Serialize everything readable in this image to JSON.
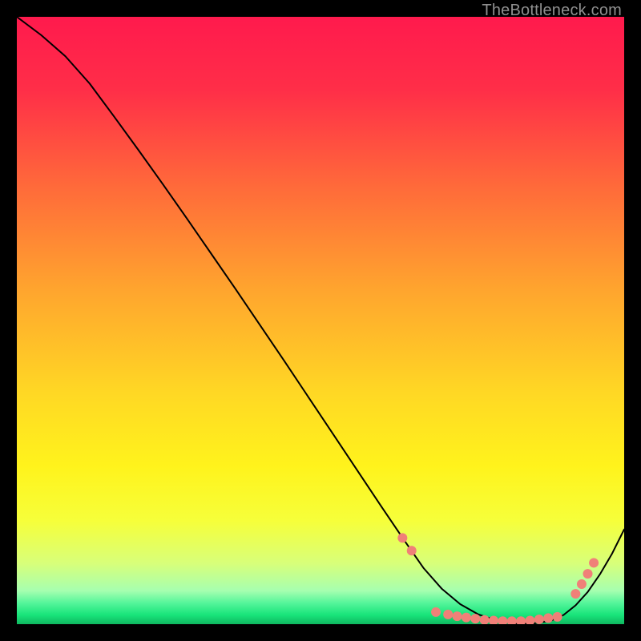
{
  "watermark": "TheBottleneck.com",
  "chart_data": {
    "type": "line",
    "title": "",
    "xlabel": "",
    "ylabel": "",
    "xlim": [
      0,
      100
    ],
    "ylim": [
      0,
      100
    ],
    "gradient_stops": [
      {
        "offset": 0.0,
        "color": "#ff1a4d"
      },
      {
        "offset": 0.12,
        "color": "#ff2e48"
      },
      {
        "offset": 0.28,
        "color": "#ff6a3a"
      },
      {
        "offset": 0.45,
        "color": "#ffa52e"
      },
      {
        "offset": 0.62,
        "color": "#ffd824"
      },
      {
        "offset": 0.74,
        "color": "#fff31c"
      },
      {
        "offset": 0.83,
        "color": "#f6ff3a"
      },
      {
        "offset": 0.9,
        "color": "#d8ff7a"
      },
      {
        "offset": 0.945,
        "color": "#a6ffb0"
      },
      {
        "offset": 0.965,
        "color": "#55f59a"
      },
      {
        "offset": 0.985,
        "color": "#18e47a"
      },
      {
        "offset": 1.0,
        "color": "#0fb85f"
      }
    ],
    "series": [
      {
        "name": "bottleneck-curve",
        "stroke": "#000000",
        "stroke_width": 2,
        "x": [
          0,
          4,
          8,
          12,
          16,
          20,
          24,
          28,
          32,
          36,
          40,
          44,
          48,
          52,
          56,
          60,
          64,
          67,
          70,
          73,
          76,
          79,
          82,
          85,
          88,
          90,
          92,
          94,
          96,
          98,
          100
        ],
        "y": [
          100,
          97,
          93.5,
          89,
          83.6,
          78.1,
          72.5,
          66.8,
          61.0,
          55.2,
          49.3,
          43.4,
          37.4,
          31.4,
          25.4,
          19.4,
          13.5,
          9.2,
          5.8,
          3.3,
          1.6,
          0.6,
          0.1,
          0.1,
          0.6,
          1.5,
          3.1,
          5.3,
          8.2,
          11.6,
          15.6
        ]
      }
    ],
    "markers": {
      "color": "#f08078",
      "radius": 6,
      "points": [
        {
          "x": 63.5,
          "y": 14.2
        },
        {
          "x": 65.0,
          "y": 12.1
        },
        {
          "x": 69.0,
          "y": 2.0
        },
        {
          "x": 71.0,
          "y": 1.6
        },
        {
          "x": 72.5,
          "y": 1.3
        },
        {
          "x": 74.0,
          "y": 1.1
        },
        {
          "x": 75.5,
          "y": 0.9
        },
        {
          "x": 77.0,
          "y": 0.7
        },
        {
          "x": 78.5,
          "y": 0.6
        },
        {
          "x": 80.0,
          "y": 0.5
        },
        {
          "x": 81.5,
          "y": 0.5
        },
        {
          "x": 83.0,
          "y": 0.5
        },
        {
          "x": 84.5,
          "y": 0.6
        },
        {
          "x": 86.0,
          "y": 0.8
        },
        {
          "x": 87.5,
          "y": 1.0
        },
        {
          "x": 89.0,
          "y": 1.2
        },
        {
          "x": 92.0,
          "y": 5.0
        },
        {
          "x": 93.0,
          "y": 6.6
        },
        {
          "x": 94.0,
          "y": 8.3
        },
        {
          "x": 95.0,
          "y": 10.1
        }
      ]
    }
  }
}
